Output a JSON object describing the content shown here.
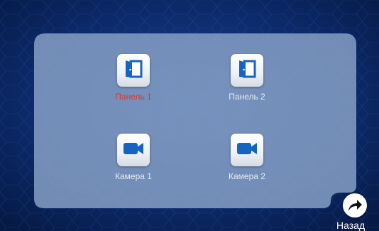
{
  "colors": {
    "background": "#0c2a6a",
    "panel": "#7d96be",
    "icon_blue": "#1565c0",
    "active_label": "#e8322c",
    "label": "#e6ecf4"
  },
  "tiles": [
    {
      "label": "Панель 1",
      "icon": "door-open-icon",
      "selected": true
    },
    {
      "label": "Панель 2",
      "icon": "door-open-icon",
      "selected": false
    },
    {
      "label": "Камера 1",
      "icon": "video-camera-icon",
      "selected": false
    },
    {
      "label": "Камера 2",
      "icon": "video-camera-icon",
      "selected": false
    }
  ],
  "back": {
    "label": "Назад",
    "icon": "arrow-forward-icon"
  }
}
